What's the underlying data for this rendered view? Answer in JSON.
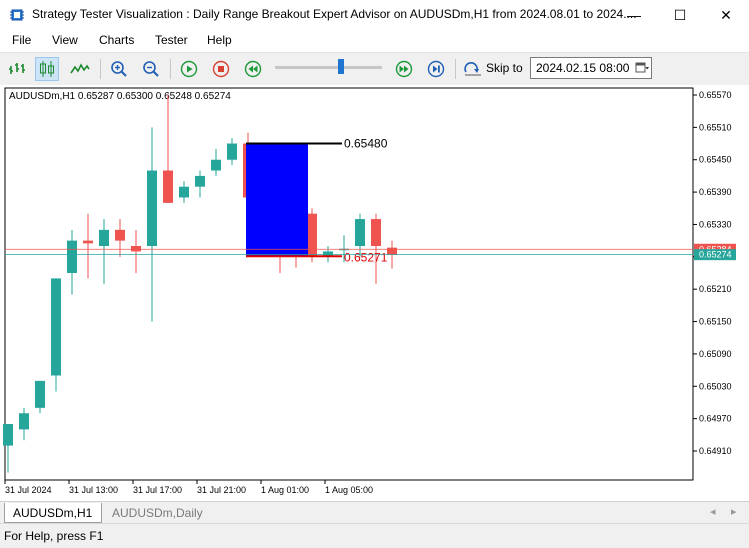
{
  "window": {
    "title": "Strategy Tester Visualization : Daily Range Breakout Expert Advisor on AUDUSDm,H1 from 2024.08.01 to 2024....",
    "minimize_glyph": "—",
    "maximize_glyph": "☐",
    "close_glyph": "✕"
  },
  "menu": [
    "File",
    "View",
    "Charts",
    "Tester",
    "Help"
  ],
  "toolbar": {
    "skip_label": "Skip to",
    "skip_date": "2024.02.15 08:00",
    "speed_fraction": 0.62
  },
  "chart_data": {
    "type": "candlestick",
    "symbol_info": "AUDUSDm,H1  0.65287 0.65300 0.65248 0.65274",
    "y_ticks": [
      "0.65570",
      "0.65510",
      "0.65450",
      "0.65390",
      "0.65330",
      "0.65270",
      "0.65210",
      "0.65150",
      "0.65090",
      "0.65030",
      "0.64970",
      "0.64910"
    ],
    "x_ticks": [
      "31 Jul 2024",
      "31 Jul 13:00",
      "31 Jul 17:00",
      "31 Jul 21:00",
      "1 Aug 01:00",
      "1 Aug 05:00"
    ],
    "price_labels": [
      "0.65284",
      "0.65274"
    ],
    "range_high": "0.65480",
    "range_low": "0.65271",
    "candles": [
      {
        "o": 0.6492,
        "h": 0.6496,
        "l": 0.6487,
        "c": 0.6496
      },
      {
        "o": 0.6495,
        "h": 0.6499,
        "l": 0.6493,
        "c": 0.6498
      },
      {
        "o": 0.6499,
        "h": 0.6504,
        "l": 0.6498,
        "c": 0.6504
      },
      {
        "o": 0.6505,
        "h": 0.6523,
        "l": 0.6502,
        "c": 0.6523
      },
      {
        "o": 0.6524,
        "h": 0.6532,
        "l": 0.652,
        "c": 0.653
      },
      {
        "o": 0.653,
        "h": 0.6535,
        "l": 0.6523,
        "c": 0.65295
      },
      {
        "o": 0.6529,
        "h": 0.6534,
        "l": 0.6522,
        "c": 0.6532
      },
      {
        "o": 0.6532,
        "h": 0.6534,
        "l": 0.6527,
        "c": 0.653
      },
      {
        "o": 0.6529,
        "h": 0.6532,
        "l": 0.6524,
        "c": 0.6528
      },
      {
        "o": 0.6529,
        "h": 0.6551,
        "l": 0.6515,
        "c": 0.6543
      },
      {
        "o": 0.6543,
        "h": 0.6557,
        "l": 0.6537,
        "c": 0.6537
      },
      {
        "o": 0.6538,
        "h": 0.6541,
        "l": 0.6537,
        "c": 0.654
      },
      {
        "o": 0.654,
        "h": 0.6543,
        "l": 0.6538,
        "c": 0.6542
      },
      {
        "o": 0.6543,
        "h": 0.6547,
        "l": 0.6542,
        "c": 0.6545
      },
      {
        "o": 0.6545,
        "h": 0.6549,
        "l": 0.6544,
        "c": 0.6548
      },
      {
        "o": 0.6548,
        "h": 0.655,
        "l": 0.6537,
        "c": 0.6538
      },
      {
        "o": 0.6538,
        "h": 0.6541,
        "l": 0.6535,
        "c": 0.6537
      },
      {
        "o": 0.6539,
        "h": 0.6545,
        "l": 0.6524,
        "c": 0.6535
      },
      {
        "o": 0.6535,
        "h": 0.6538,
        "l": 0.6525,
        "c": 0.6532
      },
      {
        "o": 0.6535,
        "h": 0.6536,
        "l": 0.6526,
        "c": 0.6527
      },
      {
        "o": 0.6527,
        "h": 0.6529,
        "l": 0.6526,
        "c": 0.6528
      },
      {
        "o": 0.65285,
        "h": 0.6531,
        "l": 0.6526,
        "c": 0.65285
      },
      {
        "o": 0.6529,
        "h": 0.6535,
        "l": 0.6527,
        "c": 0.6534
      },
      {
        "o": 0.6534,
        "h": 0.6535,
        "l": 0.6522,
        "c": 0.6529
      },
      {
        "o": 0.65287,
        "h": 0.653,
        "l": 0.65248,
        "c": 0.65274
      }
    ],
    "colors": {
      "up": "#26a69a",
      "down": "#ef5350",
      "range_box": "#0000ff",
      "range_high_line": "#000000",
      "range_low_line": "#e00000",
      "bid_line": "#ef5350",
      "ask_line": "#26a69a",
      "bid_label_bg": "#ef5350",
      "ask_label_bg": "#26a69a"
    }
  },
  "tabs": {
    "active": "AUDUSDm,H1",
    "inactive": "AUDUSDm,Daily"
  },
  "status": {
    "text": "For Help, press F1"
  }
}
